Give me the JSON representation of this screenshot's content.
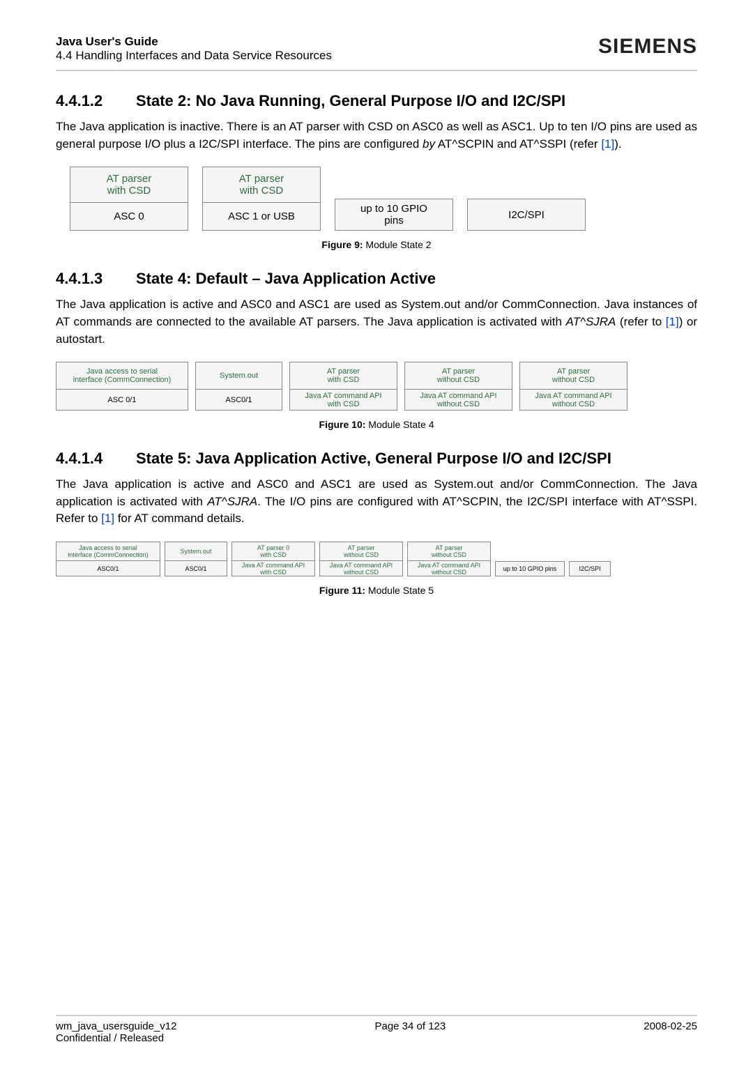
{
  "header": {
    "title": "Java User's Guide",
    "subtitle": "4.4 Handling Interfaces and Data Service Resources",
    "brand": "SIEMENS"
  },
  "sec1": {
    "num": "4.4.1.2",
    "title": "State 2: No Java Running, General Purpose I/O and I2C/SPI",
    "para_a": "The Java application is inactive. There is an AT parser with CSD on ASC0 as well as ASC1. Up to ten I/O pins are used as general purpose I/O plus a I2C/SPI interface. The pins are configured ",
    "para_b_italic": "by",
    "para_c": " AT^SCPIN and AT^SSPI (refer ",
    "ref": "[1]",
    "para_d": ")."
  },
  "fig9": {
    "b1": {
      "top": "AT parser\nwith CSD",
      "bot": "ASC 0"
    },
    "b2": {
      "top": "AT parser\nwith CSD",
      "bot": "ASC 1 or USB"
    },
    "b3": "up to 10 GPIO\npins",
    "b4": "I2C/SPI",
    "caption_b": "Figure 9:",
    "caption_t": "  Module State 2"
  },
  "sec2": {
    "num": "4.4.1.3",
    "title": "State 4: Default – Java Application Active",
    "para_a": "The Java application is active and ASC0 and ASC1 are used as System.out and/or CommConnection. Java instances of AT commands are connected to the available AT parsers. The Java application is activated with ",
    "para_b_italic": "AT^SJRA",
    "para_c": " (refer to ",
    "ref": "[1]",
    "para_d": ") or autostart."
  },
  "fig10": {
    "c1": {
      "top": "Java access to serial\ninterface (CommConnection)",
      "bot": "ASC 0/1"
    },
    "c2": {
      "top": "System.out",
      "bot": "ASC0/1"
    },
    "c3": {
      "top": "AT parser\nwith CSD",
      "bot": "Java AT command API\nwith CSD"
    },
    "c4": {
      "top": "AT parser\nwithout CSD",
      "bot": "Java AT command API\nwithout CSD"
    },
    "c5": {
      "top": "AT parser\nwithout CSD",
      "bot": "Java AT command API\nwithout CSD"
    },
    "caption_b": "Figure 10:",
    "caption_t": "  Module State 4"
  },
  "sec3": {
    "num": "4.4.1.4",
    "title": "State 5: Java Application Active, General Purpose I/O and I2C/SPI",
    "para_a": "The Java application is active and ASC0 and ASC1 are used as System.out and/or CommConnection. The Java application is activated with ",
    "para_b_italic": "AT^SJRA",
    "para_c": ". The I/O pins are configured with AT^SCPIN, the I2C/SPI interface with AT^SSPI. Refer to ",
    "ref": "[1]",
    "para_d": " for AT command details."
  },
  "fig11": {
    "c1": {
      "top": "Java access to serial\ninterface (CommConnection)",
      "bot": "ASC0/1"
    },
    "c2": {
      "top": "System.out",
      "bot": "ASC0/1"
    },
    "c3": {
      "top": "AT parser 0\nwith CSD",
      "bot": "Java AT command API\nwith CSD"
    },
    "c4": {
      "top": "AT parser\nwithout CSD",
      "bot": "Java AT command API\nwithout CSD"
    },
    "c5": {
      "top": "AT parser\nwithout CSD",
      "bot": "Java AT command API\nwithout CSD"
    },
    "c6": "up to 10 GPIO pins",
    "c7": "I2C/SPI",
    "caption_b": "Figure 11:",
    "caption_t": "  Module State 5"
  },
  "footer": {
    "left1": "wm_java_usersguide_v12",
    "left2": "Confidential / Released",
    "center": "Page 34 of 123",
    "right": "2008-02-25"
  }
}
